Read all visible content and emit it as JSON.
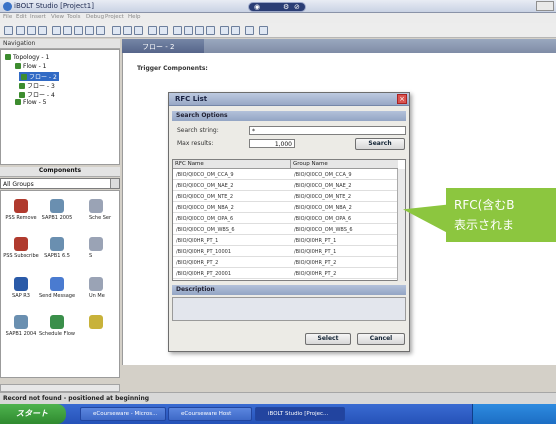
{
  "window": {
    "title": "iBOLT Studio [Project1]"
  },
  "menubar": {
    "items": [
      "File",
      "Edit",
      "Insert",
      "View",
      "Tools",
      "Debug",
      "Project",
      "Help"
    ]
  },
  "navigation": {
    "header": "Navigation",
    "tree": [
      {
        "label": "Topology - 1",
        "level": 0
      },
      {
        "label": "Flow - 1",
        "level": 1
      },
      {
        "label": "フロー - 2",
        "level": 2
      },
      {
        "label": "フロー - 3",
        "level": 2
      },
      {
        "label": "フロー - 4",
        "level": 2
      },
      {
        "label": "Flow - 5",
        "level": 1
      }
    ]
  },
  "editor": {
    "tab_label": "フロー - 2",
    "canvas_heading": "Trigger Components:"
  },
  "components": {
    "header": "Components",
    "group_selected": "All Groups",
    "items": [
      {
        "label": "PSS Remove",
        "color": "#b03a2e"
      },
      {
        "label": "SAPB1 2005",
        "color": "#6a8fb0"
      },
      {
        "label": "Sche Ser",
        "color": "#9aa3b5"
      },
      {
        "label": "PSS Subscribe",
        "color": "#b03a2e"
      },
      {
        "label": "SAPB1 6.5",
        "color": "#6a8fb0"
      },
      {
        "label": "S",
        "color": "#9aa3b5"
      },
      {
        "label": "SAP R3",
        "color": "#2a5aa8"
      },
      {
        "label": "Send Message",
        "color": "#4a7bd0"
      },
      {
        "label": "Un Me",
        "color": "#9aa3b5"
      },
      {
        "label": "SAPB1 2004",
        "color": "#6a8fb0"
      },
      {
        "label": "Schedule Flow",
        "color": "#3a8f4a"
      },
      {
        "label": "",
        "color": "#c8b23a"
      }
    ]
  },
  "dialog": {
    "title": "RFC List",
    "search_section": "Search Options",
    "search_label": "Search string:",
    "search_value": "*",
    "max_label": "Max results:",
    "max_value": "1,000",
    "search_button": "Search",
    "columns": [
      "RFC Name",
      "Group Name"
    ],
    "rows": [
      [
        "/BIO/QI0CO_OM_CCA_9",
        "/BIO/QI0CO_OM_CCA_9"
      ],
      [
        "/BIO/QI0CO_OM_NAE_2",
        "/BIO/QI0CO_OM_NAE_2"
      ],
      [
        "/BIO/QI0CO_OM_NTE_2",
        "/BIO/QI0CO_OM_NTE_2"
      ],
      [
        "/BIO/QI0CO_OM_NBA_2",
        "/BIO/QI0CO_OM_NBA_2"
      ],
      [
        "/BIO/QI0CO_OM_OPA_6",
        "/BIO/QI0CO_OM_OPA_6"
      ],
      [
        "/BIO/QI0CO_OM_WBS_6",
        "/BIO/QI0CO_OM_WBS_6"
      ],
      [
        "/BIO/QI0HR_PT_1",
        "/BIO/QI0HR_PT_1"
      ],
      [
        "/BIO/QI0HR_PT_10001",
        "/BIO/QI0HR_PT_1"
      ],
      [
        "/BIO/QI0HR_PT_2",
        "/BIO/QI0HR_PT_2"
      ],
      [
        "/BIO/QI0HR_PT_20001",
        "/BIO/QI0HR_PT_2"
      ]
    ],
    "description_label": "Description",
    "select_button": "Select",
    "cancel_button": "Cancel"
  },
  "callout": {
    "line1": "RFC(含むB",
    "line2": "表示されま",
    "color": "#8cc63f"
  },
  "status": {
    "text": "Record not found - positioned at beginning"
  },
  "taskbar": {
    "start_label": "スタート",
    "tasks": [
      "eCourseware - Micros...",
      "eCourseware Host",
      "iBOLT Studio [Projec..."
    ]
  }
}
